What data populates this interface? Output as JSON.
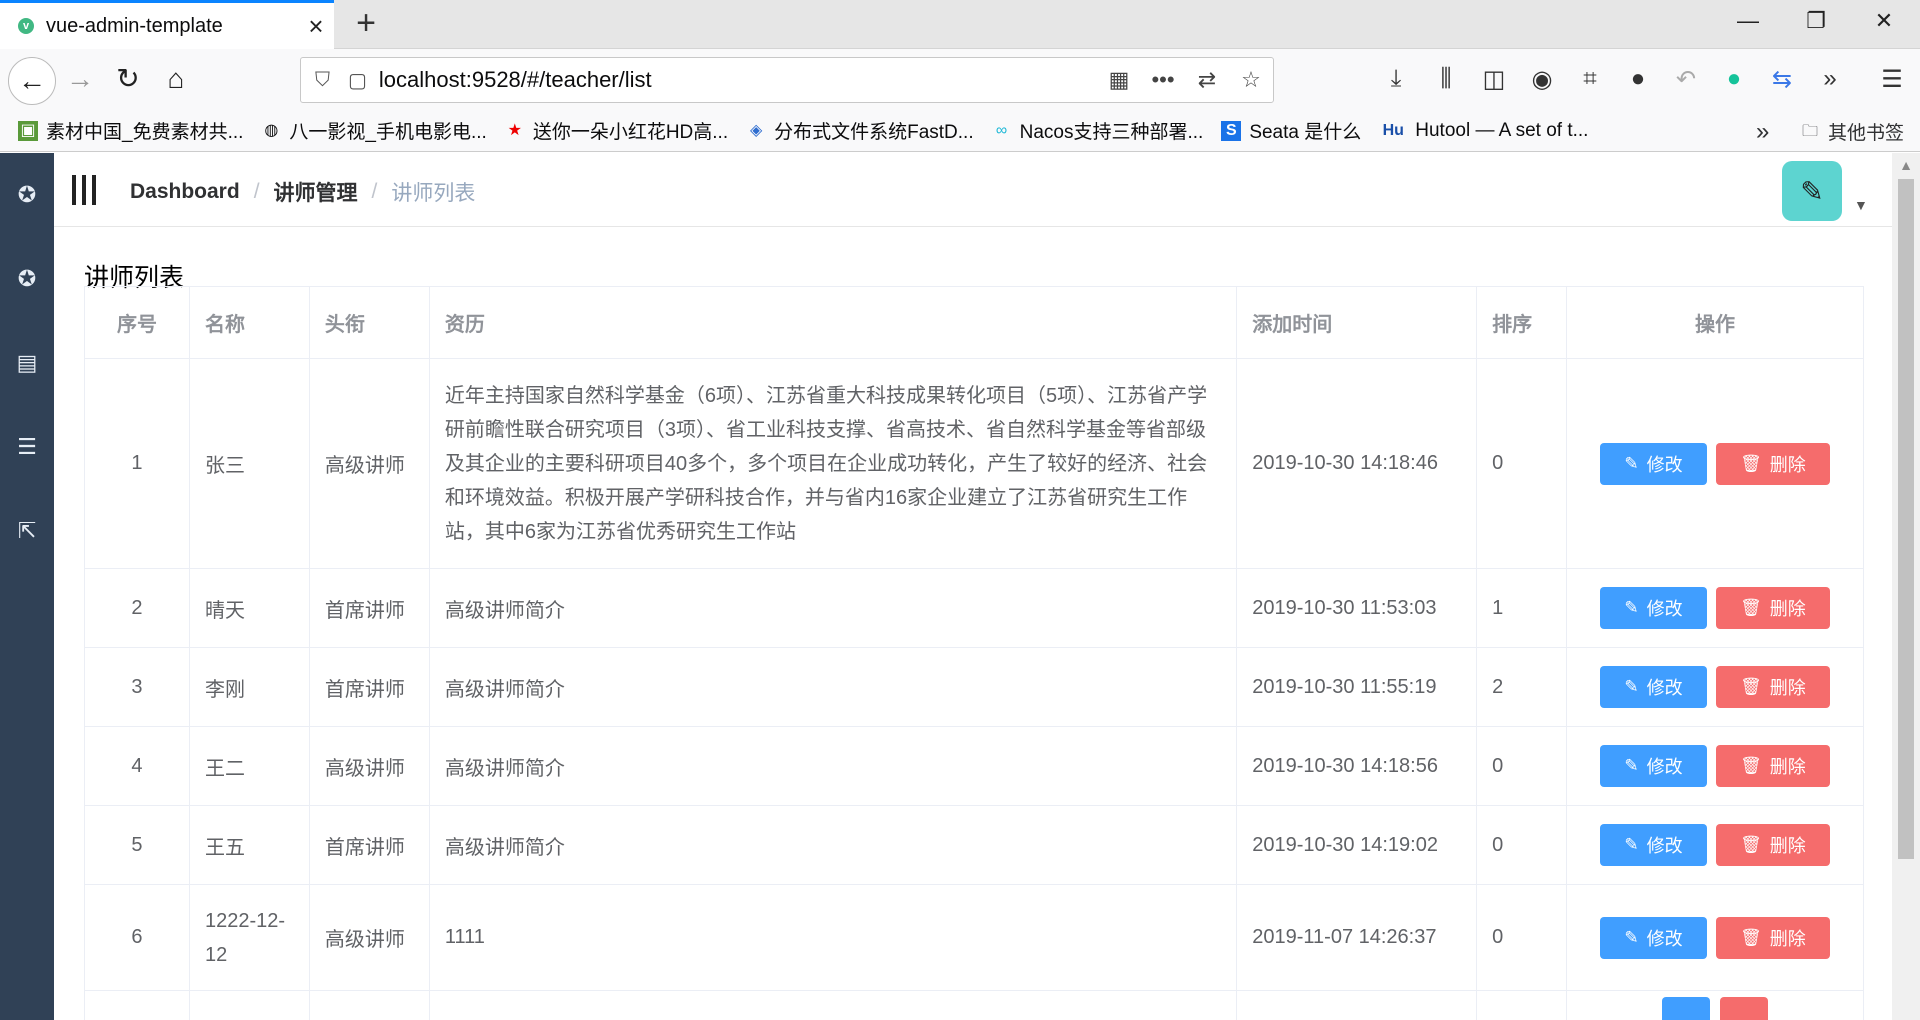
{
  "browser": {
    "tab_title": "vue-admin-template",
    "url": "localhost:9528/#/teacher/list",
    "bookmarks": [
      {
        "icon": "image-icon",
        "label": "素材中国_免费素材共..."
      },
      {
        "icon": "globe-icon",
        "label": "八一影视_手机电影电..."
      },
      {
        "icon": "star-icon",
        "label": "送你一朵小红花HD高..."
      },
      {
        "icon": "shield-bm-icon",
        "label": "分布式文件系统FastD..."
      },
      {
        "icon": "infinity-icon",
        "label": "Nacos支持三种部署..."
      },
      {
        "icon": "s-icon",
        "label": "Seata 是什么"
      },
      {
        "icon": "hu-icon",
        "label": "Hutool — A set of t..."
      }
    ],
    "other_bookmarks": "其他书签"
  },
  "header": {
    "breadcrumb": [
      "Dashboard",
      "讲师管理",
      "讲师列表"
    ]
  },
  "page": {
    "title": "讲师列表"
  },
  "table": {
    "columns": [
      "序号",
      "名称",
      "头衔",
      "资历",
      "添加时间",
      "排序",
      "操作"
    ],
    "rows": [
      {
        "index": "1",
        "name": "张三",
        "level": "高级讲师",
        "intro": "近年主持国家自然科学基金（6项）、江苏省重大科技成果转化项目（5项）、江苏省产学研前瞻性联合研究项目（3项）、省工业科技支撑、省高技术、省自然科学基金等省部级及其企业的主要科研项目40多个，多个项目在企业成功转化，产生了较好的经济、社会和环境效益。积极开展产学研科技合作，并与省内16家企业建立了江苏省研究生工作站，其中6家为江苏省优秀研究生工作站",
        "time": "2019-10-30 14:18:46",
        "sort": "0"
      },
      {
        "index": "2",
        "name": "晴天",
        "level": "首席讲师",
        "intro": "高级讲师简介",
        "time": "2019-10-30 11:53:03",
        "sort": "1"
      },
      {
        "index": "3",
        "name": "李刚",
        "level": "首席讲师",
        "intro": "高级讲师简介",
        "time": "2019-10-30 11:55:19",
        "sort": "2"
      },
      {
        "index": "4",
        "name": "王二",
        "level": "高级讲师",
        "intro": "高级讲师简介",
        "time": "2019-10-30 14:18:56",
        "sort": "0"
      },
      {
        "index": "5",
        "name": "王五",
        "level": "首席讲师",
        "intro": "高级讲师简介",
        "time": "2019-10-30 14:19:02",
        "sort": "0"
      },
      {
        "index": "6",
        "name": "1222-12-12",
        "level": "高级讲师",
        "intro": "1111",
        "time": "2019-11-07 14:26:37",
        "sort": "0"
      }
    ],
    "edit_label": "修改",
    "delete_label": "删除"
  },
  "colors": {
    "sidebar": "#304156",
    "primary": "#409eff",
    "danger": "#f56c6c"
  }
}
